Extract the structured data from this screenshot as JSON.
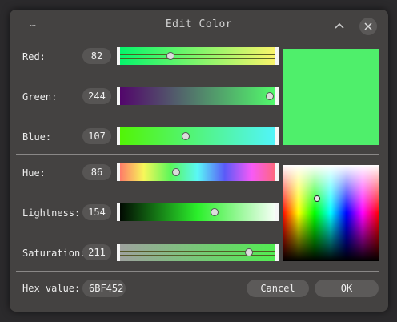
{
  "window": {
    "title": "Edit Color",
    "menu_glyph": "⋯",
    "collapse_glyph": "︿",
    "close_glyph": "✕"
  },
  "preview_color": "#4FEF6B",
  "rgb": {
    "red": {
      "label": "Red:",
      "value": "82",
      "fraction": 0.32
    },
    "green": {
      "label": "Green:",
      "value": "244",
      "fraction": 0.957
    },
    "blue": {
      "label": "Blue:",
      "value": "107",
      "fraction": 0.42
    }
  },
  "hsl": {
    "hue": {
      "label": "Hue:",
      "value": "86",
      "fraction": 0.358
    },
    "lightness": {
      "label": "Lightness:",
      "value": "154",
      "fraction": 0.604
    },
    "saturation": {
      "label": "Saturation:",
      "value": "211",
      "fraction": 0.827
    }
  },
  "picker": {
    "cursor_hue_fraction": 0.358,
    "cursor_level_fraction": 0.35
  },
  "hex": {
    "label": "Hex value:",
    "value": "6BF452"
  },
  "buttons": {
    "cancel": "Cancel",
    "ok": "OK"
  },
  "icons": {
    "menu": "dots-menu-icon",
    "collapse": "chevron-up-icon",
    "close": "close-icon"
  }
}
